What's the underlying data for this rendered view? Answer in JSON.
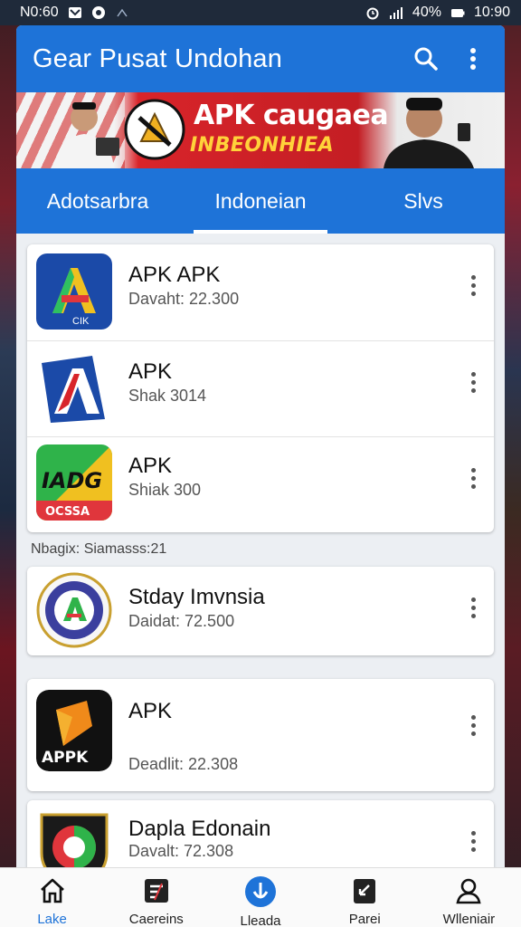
{
  "status_bar": {
    "time_left": "N0:60",
    "battery": "40%",
    "clock": "10:90"
  },
  "app_bar": {
    "title": "Gear Pusat Undohan",
    "search_icon": "search-icon",
    "menu_icon": "more-vert-icon"
  },
  "banner": {
    "title": "APK caugaea",
    "subtitle": "INBEONHIEA"
  },
  "tabs": [
    {
      "label": "Adotsarbra",
      "active": false
    },
    {
      "label": "Indoneian",
      "active": true
    },
    {
      "label": "Slvs",
      "active": false
    }
  ],
  "group1": [
    {
      "name": "APK APK",
      "meta": "Davaht: 22.300",
      "icon": "app-a-blue-icon"
    },
    {
      "name": "APK",
      "meta": "Shak 3014",
      "icon": "app-a-red-icon"
    },
    {
      "name": "APK",
      "meta": "Shiak 300",
      "icon": "app-adg-green-icon"
    }
  ],
  "section_label": "Nbagix: Siamasss:21",
  "group2": [
    {
      "name": "Stday Imvnsia",
      "meta": "Daidat: 72.500",
      "icon": "app-seal-icon"
    }
  ],
  "group3": [
    {
      "name": "APK",
      "meta": "Deadlit: 22.308",
      "icon": "app-apk-black-icon",
      "icon_text": "APPK"
    }
  ],
  "group4": [
    {
      "name": "Dapla Edonain",
      "meta": "Davalt: 72.308",
      "icon": "app-badge-icon"
    }
  ],
  "bottom_nav": [
    {
      "label": "Lake",
      "icon": "home-icon",
      "active": true
    },
    {
      "label": "Caereins",
      "icon": "categories-icon",
      "active": false
    },
    {
      "label": "Lleada",
      "icon": "download-icon",
      "active": false
    },
    {
      "label": "Parei",
      "icon": "update-icon",
      "active": false
    },
    {
      "label": "Wlleniair",
      "icon": "profile-icon",
      "active": false
    }
  ],
  "colors": {
    "primary": "#1e73d8",
    "background": "#eceff3",
    "banner_red": "#c41e24",
    "banner_yellow": "#ffd23a"
  }
}
